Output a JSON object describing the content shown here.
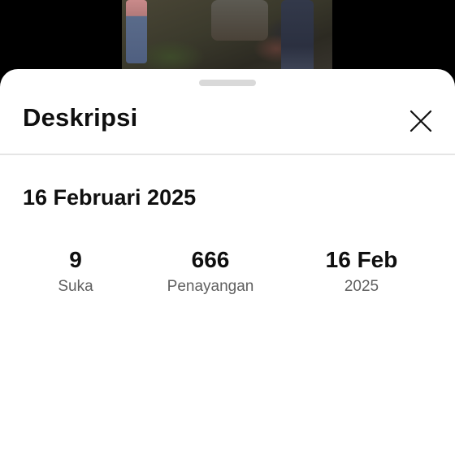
{
  "sheet": {
    "title": "Deskripsi",
    "close_icon": "close-icon"
  },
  "description": {
    "date": "16 Februari 2025"
  },
  "stats": [
    {
      "value": "9",
      "label": "Suka"
    },
    {
      "value": "666",
      "label": "Penayangan"
    },
    {
      "value": "16 Feb",
      "label": "2025"
    }
  ]
}
